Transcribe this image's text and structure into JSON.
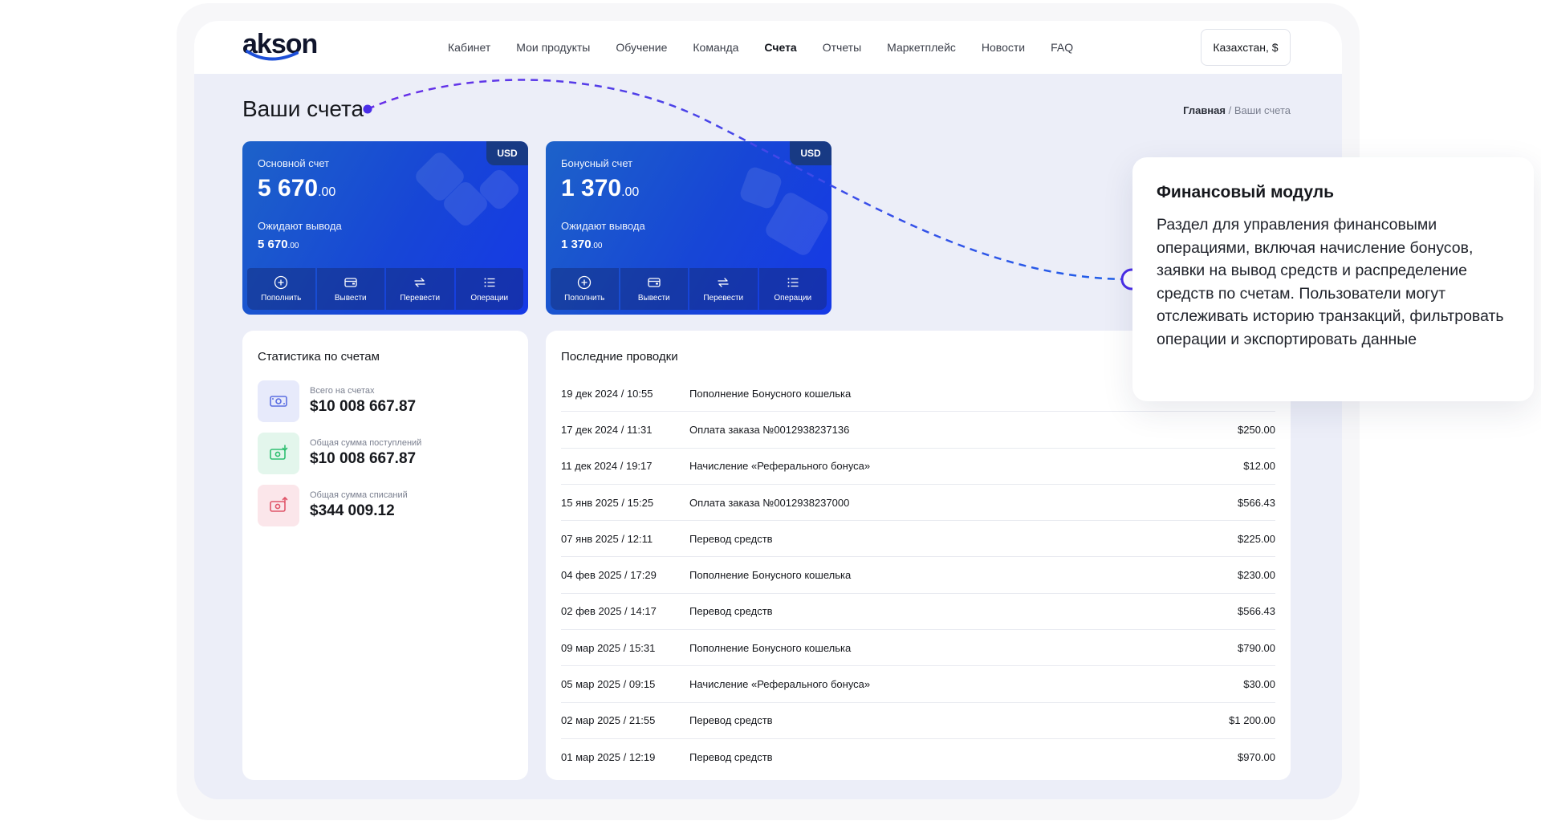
{
  "brand": {
    "logo_text": "akson"
  },
  "nav": {
    "items": [
      {
        "label": "Кабинет",
        "active": false
      },
      {
        "label": "Мои продукты",
        "active": false
      },
      {
        "label": "Обучение",
        "active": false
      },
      {
        "label": "Команда",
        "active": false
      },
      {
        "label": "Счета",
        "active": true
      },
      {
        "label": "Отчеты",
        "active": false
      },
      {
        "label": "Маркетплейс",
        "active": false
      },
      {
        "label": "Новости",
        "active": false
      },
      {
        "label": "FAQ",
        "active": false
      }
    ],
    "region_label": "Казахстан, $"
  },
  "page": {
    "title": "Ваши счета",
    "breadcrumb_home": "Главная",
    "breadcrumb_sep": " / ",
    "breadcrumb_current": "Ваши счета"
  },
  "accounts": [
    {
      "currency": "USD",
      "label": "Основной счет",
      "amount_int": "5 670",
      "amount_cents": ".00",
      "wait_label": "Ожидают вывода",
      "wait_int": "5 670",
      "wait_cents": ".00",
      "actions": [
        "Пополнить",
        "Вывести",
        "Перевести",
        "Операции"
      ]
    },
    {
      "currency": "USD",
      "label": "Бонусный счет",
      "amount_int": "1 370",
      "amount_cents": ".00",
      "wait_label": "Ожидают вывода",
      "wait_int": "1 370",
      "wait_cents": ".00",
      "actions": [
        "Пополнить",
        "Вывести",
        "Перевести",
        "Операции"
      ]
    }
  ],
  "stats": {
    "title": "Статистика по счетам",
    "items": [
      {
        "label": "Всего на счетах",
        "value": "$10 008 667.87",
        "icon": "wallet-icon",
        "color": "#5b6ee1"
      },
      {
        "label": "Общая сумма поступлений",
        "value": "$10 008 667.87",
        "icon": "cash-in-icon",
        "color": "#2fbf71"
      },
      {
        "label": "Общая сумма списаний",
        "value": "$344 009.12",
        "icon": "cash-out-icon",
        "color": "#e0566a"
      }
    ]
  },
  "transactions": {
    "title": "Последние проводки",
    "rows": [
      {
        "date": "19 дек 2024 / 10:55",
        "desc": "Пополнение Бонусного кошелька",
        "amount": ""
      },
      {
        "date": "17 дек 2024 / 11:31",
        "desc": "Оплата заказа №0012938237136",
        "amount": "$250.00"
      },
      {
        "date": "11 дек 2024 / 19:17",
        "desc": "Начисление «Реферального бонуса»",
        "amount": "$12.00"
      },
      {
        "date": "15 янв 2025 / 15:25",
        "desc": "Оплата заказа №0012938237000",
        "amount": "$566.43"
      },
      {
        "date": "07 янв 2025 / 12:11",
        "desc": "Перевод средств",
        "amount": "$225.00"
      },
      {
        "date": "04 фев 2025 / 17:29",
        "desc": "Пополнение Бонусного кошелька",
        "amount": "$230.00"
      },
      {
        "date": "02 фев 2025 / 14:17",
        "desc": "Перевод средств",
        "amount": "$566.43"
      },
      {
        "date": "09 мар 2025 / 15:31",
        "desc": "Пополнение Бонусного кошелька",
        "amount": "$790.00"
      },
      {
        "date": "05 мар 2025 / 09:15",
        "desc": "Начисление «Реферального бонуса»",
        "amount": "$30.00"
      },
      {
        "date": "02 мар 2025 / 21:55",
        "desc": "Перевод средств",
        "amount": "$1 200.00"
      },
      {
        "date": "01 мар 2025 / 12:19",
        "desc": "Перевод средств",
        "amount": "$970.00"
      }
    ]
  },
  "callout": {
    "title": "Финансовый модуль",
    "body": "Раздел для управления финансовыми операциями, включая начисление бонусов, заявки на вывод средств и распределение средств по счетам. Пользователи могут отслеживать историю транзакций, фильтровать операции и экспортировать данные"
  },
  "colors": {
    "accent": "#1746d6",
    "connector": "#6a2ee8",
    "background": "#eceef8"
  }
}
